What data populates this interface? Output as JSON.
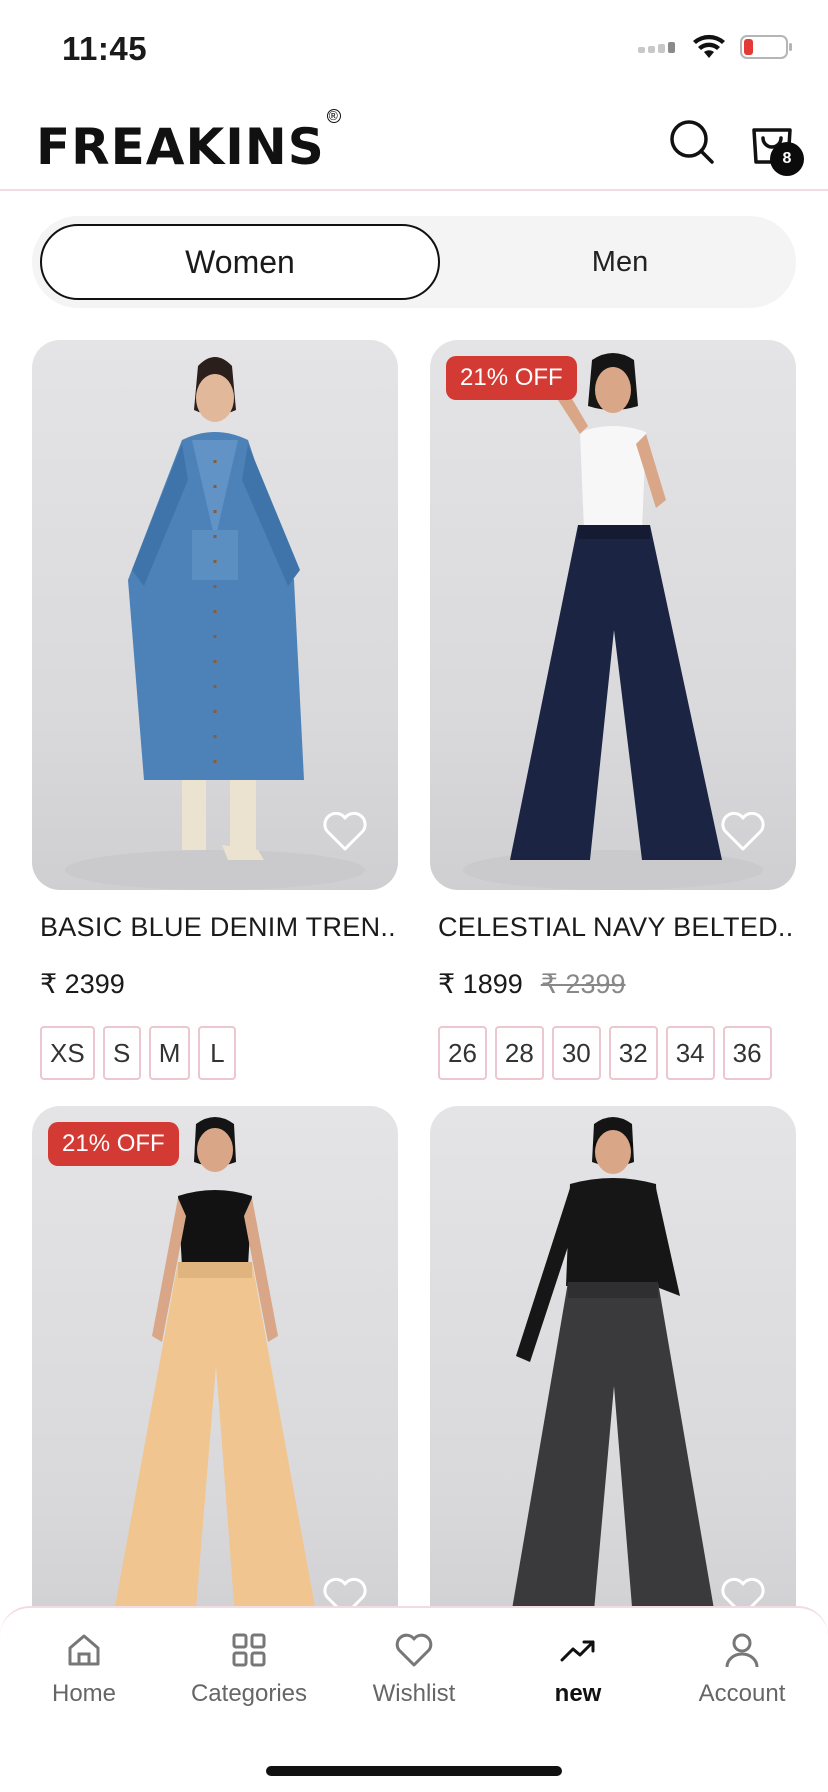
{
  "status_bar": {
    "time": "11:45"
  },
  "header": {
    "logo": "FREAKINS",
    "logo_mark": "®",
    "cart_count": "8"
  },
  "segment": {
    "women": "Women",
    "men": "Men"
  },
  "products": [
    {
      "title": "BASIC BLUE DENIM TREN...",
      "price": "₹ 2399",
      "old_price": "",
      "discount": "",
      "sizes": [
        "XS",
        "S",
        "M",
        "L"
      ]
    },
    {
      "title": "CELESTIAL NAVY BELTED...",
      "price": "₹ 1899",
      "old_price": "₹ 2399",
      "discount": "21% OFF",
      "sizes": [
        "26",
        "28",
        "30",
        "32",
        "34",
        "36"
      ]
    },
    {
      "title": "",
      "price": "",
      "old_price": "",
      "discount": "21% OFF",
      "sizes": []
    },
    {
      "title": "",
      "price": "",
      "old_price": "",
      "discount": "",
      "sizes": []
    }
  ],
  "nav": {
    "home": "Home",
    "categories": "Categories",
    "wishlist": "Wishlist",
    "new": "new",
    "account": "Account"
  },
  "colors": {
    "accent_red": "#d33a34",
    "divider_pink": "#f2dbe1",
    "size_border": "#ecc7cf"
  }
}
